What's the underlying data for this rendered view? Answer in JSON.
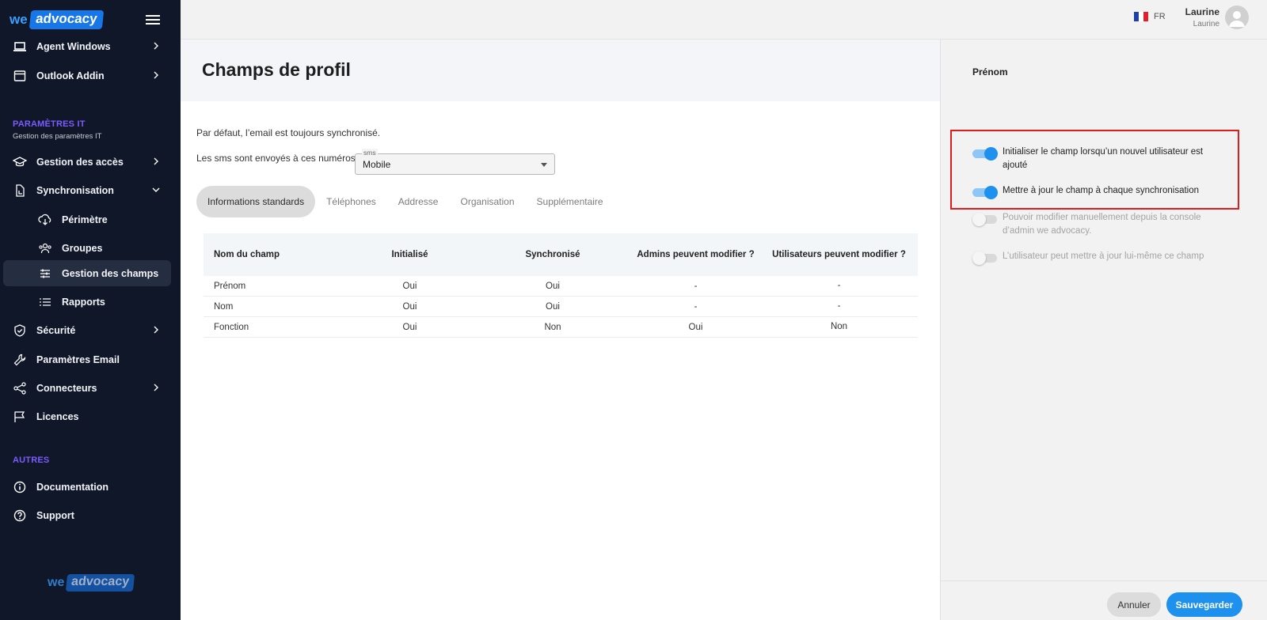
{
  "brand": {
    "we": "we",
    "advocacy": "advocacy"
  },
  "sidebar": {
    "items_top": [
      {
        "label": "Agent Windows"
      },
      {
        "label": "Outlook Addin"
      }
    ],
    "section_it": {
      "title": "PARAMÈTRES IT",
      "subtitle": "Gestion des paramètres IT"
    },
    "items_it": [
      {
        "label": "Gestion des accès"
      },
      {
        "label": "Synchronisation"
      },
      {
        "label": "Périmètre"
      },
      {
        "label": "Groupes"
      },
      {
        "label": "Gestion des champs"
      },
      {
        "label": "Rapports"
      },
      {
        "label": "Sécurité"
      },
      {
        "label": "Paramètres Email"
      },
      {
        "label": "Connecteurs"
      },
      {
        "label": "Licences"
      }
    ],
    "section_other": {
      "title": "AUTRES"
    },
    "items_other": [
      {
        "label": "Documentation"
      },
      {
        "label": "Support"
      }
    ],
    "active": "Gestion des champs"
  },
  "topbar": {
    "language": "FR",
    "user_name": "Laurine",
    "user_sub": "Laurine"
  },
  "page": {
    "title": "Champs de profil",
    "note": "Par défaut, l’email est toujours synchronisé.",
    "sms_label": "Les sms sont envoyés à ces numéros",
    "sms_select": {
      "legend": "sms",
      "value": "Mobile"
    },
    "tabs": [
      {
        "label": "Informations standards",
        "active": true
      },
      {
        "label": "Téléphones"
      },
      {
        "label": "Addresse"
      },
      {
        "label": "Organisation"
      },
      {
        "label": "Supplémentaire"
      }
    ],
    "table": {
      "headers": [
        "Nom du champ",
        "Initialisé",
        "Synchronisé",
        "Admins peuvent modifier ?",
        "Utilisateurs peuvent modifier ?"
      ],
      "rows": [
        [
          "Prénom",
          "Oui",
          "Oui",
          "-",
          "-"
        ],
        [
          "Nom",
          "Oui",
          "Oui",
          "-",
          "-"
        ],
        [
          "Fonction",
          "Oui",
          "Non",
          "Oui",
          "Non"
        ]
      ]
    }
  },
  "panel": {
    "title": "Prénom",
    "options": [
      {
        "label": "Initialiser le champ lorsqu’un nouvel utilisateur est ajouté",
        "on": true,
        "disabled": false
      },
      {
        "label": "Mettre à jour le champ à chaque synchronisation",
        "on": true,
        "disabled": false
      },
      {
        "label": "Pouvoir modifier manuellement depuis la console d’admin we advocacy.",
        "on": false,
        "disabled": true
      },
      {
        "label": "L’utilisateur peut mettre à jour lui-même ce champ",
        "on": false,
        "disabled": true
      }
    ],
    "cancel_label": "Annuler",
    "save_label": "Sauvegarder"
  },
  "colors": {
    "sidebar_bg": "#0f1729",
    "section_accent": "#7c5cff",
    "primary": "#1e90ee",
    "highlight_border": "#e01d1d"
  },
  "icons": {
    "agent_windows": "laptop-icon",
    "outlook_addin": "window-icon",
    "gestion_acces": "graduation-cap-icon",
    "synchronisation": "sync-doc-icon",
    "perimetre": "download-cloud-icon",
    "groupes": "users-icon",
    "gestion_champs": "sliders-icon",
    "rapports": "list-icon",
    "securite": "shield-check-icon",
    "parametres_email": "wrench-icon",
    "connecteurs": "share-icon",
    "licences": "flag-icon",
    "documentation": "info-icon",
    "support": "help-icon"
  }
}
